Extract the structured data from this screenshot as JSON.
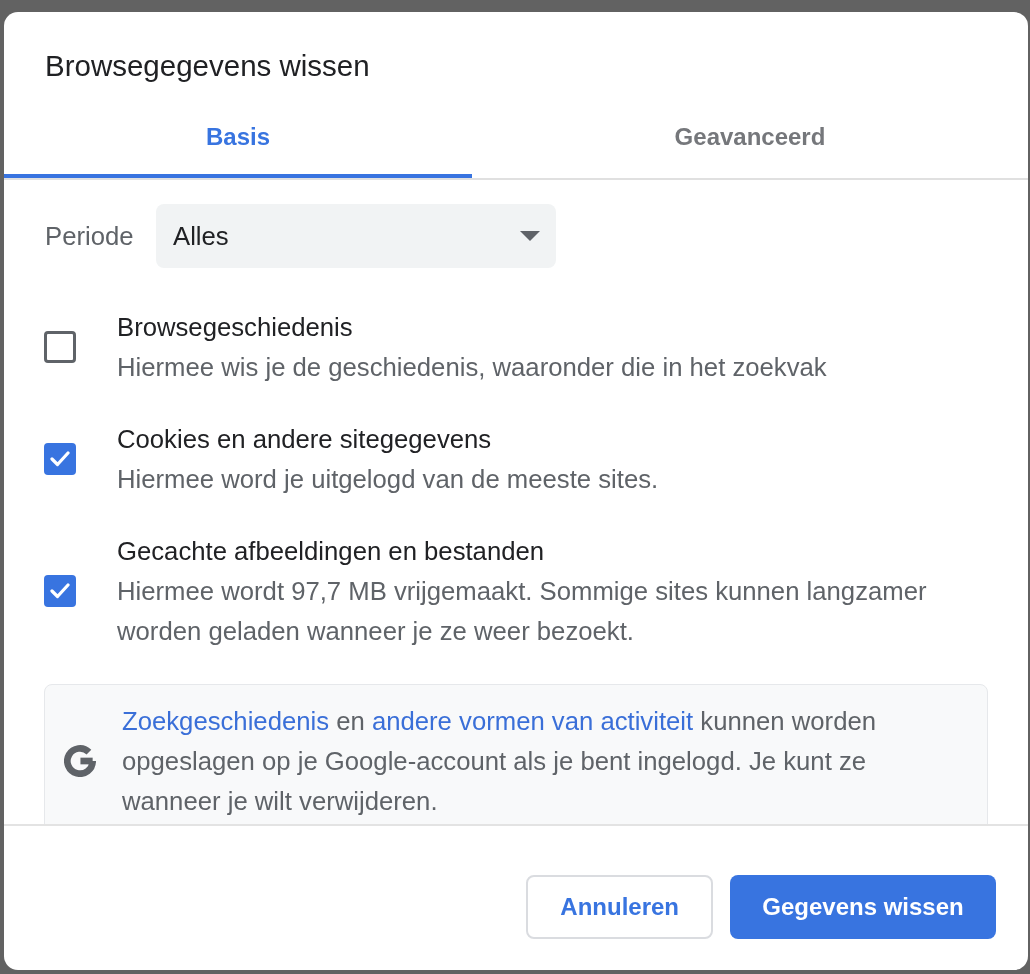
{
  "dialog": {
    "title": "Browsegegevens wissen"
  },
  "tabs": [
    {
      "label": "Basis",
      "selected": true
    },
    {
      "label": "Geavanceerd",
      "selected": false
    }
  ],
  "period": {
    "label": "Periode",
    "value": "Alles"
  },
  "options": [
    {
      "title": "Browsegeschiedenis",
      "description": "Hiermee wis je de geschiedenis, waaronder die in het zoekvak",
      "checked": false
    },
    {
      "title": "Cookies en andere sitegegevens",
      "description": "Hiermee word je uitgelogd van de meeste sites.",
      "checked": true
    },
    {
      "title": "Gecachte afbeeldingen en bestanden",
      "description": "Hiermee wordt 97,7 MB vrijgemaakt. Sommige sites kunnen langzamer worden geladen wanneer je ze weer bezoekt.",
      "checked": true
    }
  ],
  "info_box": {
    "parts": [
      {
        "kind": "link",
        "text": "Zoekgeschiedenis"
      },
      {
        "kind": "text",
        "text": " en "
      },
      {
        "kind": "link",
        "text": "andere vormen van activiteit"
      },
      {
        "kind": "text",
        "text": " kunnen worden opgeslagen op je Google-account als je bent ingelogd. Je kunt ze wanneer je wilt verwijderen."
      }
    ]
  },
  "buttons": [
    {
      "label": "Annuleren",
      "kind": "secondary"
    },
    {
      "label": "Gegevens wissen",
      "kind": "primary"
    }
  ]
}
